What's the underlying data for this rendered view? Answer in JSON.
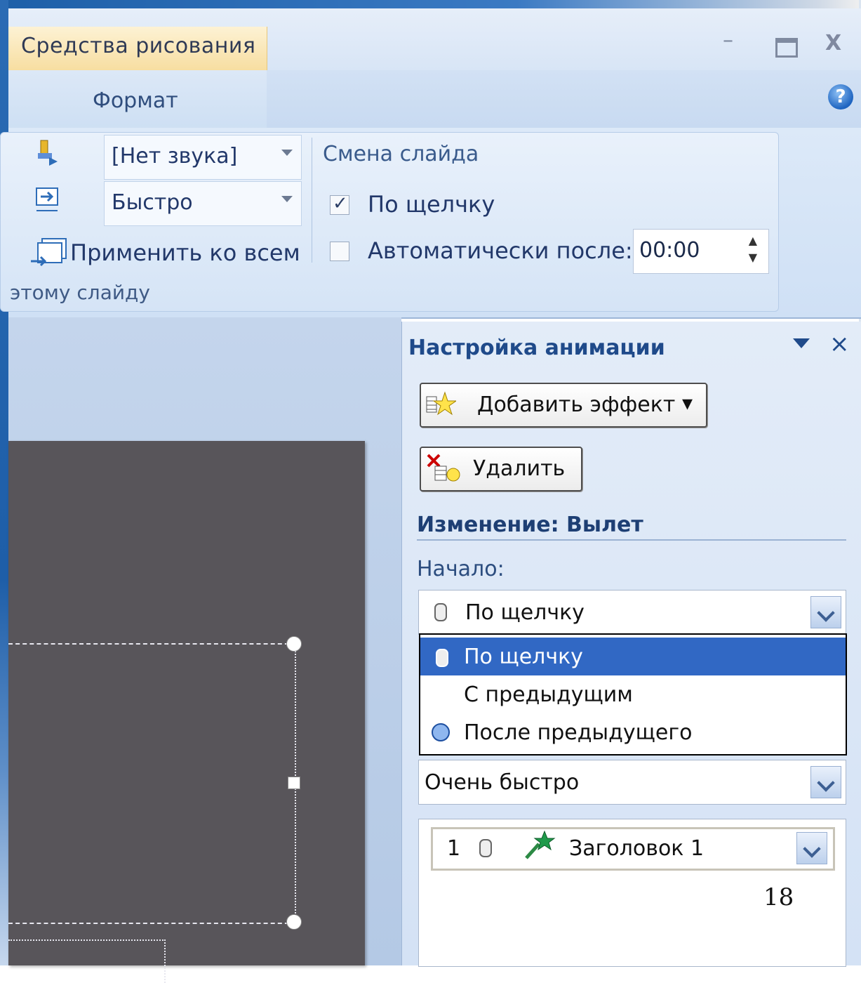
{
  "window": {
    "context_tab": "Средства рисования",
    "min": "–",
    "close": "X",
    "help": "?"
  },
  "tabs": {
    "format": "Формат"
  },
  "ribbon": {
    "sound_value": "[Нет звука]",
    "speed_value": "Быстро",
    "apply_all": "Применить ко всем",
    "group_label": "этому слайду",
    "slide_change_title": "Смена слайда",
    "on_click_label": "По щелчку",
    "on_click_checked": true,
    "auto_after_label": "Автоматически после:",
    "auto_after_checked": false,
    "auto_time": "00:00"
  },
  "pane": {
    "title": "Настройка анимации",
    "close": "×",
    "add_effect": "Добавить эффект",
    "add_arrow": "▾",
    "delete": "Удалить",
    "change_title": "Изменение: Вылет",
    "start_label": "Начало:",
    "start_value": "По щелчку",
    "start_options": [
      {
        "label": "По щелчку",
        "icon": "mouse-icon",
        "selected": true
      },
      {
        "label": "С предыдущим",
        "icon": "",
        "selected": false
      },
      {
        "label": "После предыдущего",
        "icon": "clock-icon",
        "selected": false
      }
    ],
    "speed_value": "Очень быстро",
    "sequence": [
      {
        "num": "1",
        "name": "Заголовок 1"
      }
    ]
  },
  "page_number": "18",
  "colors": {
    "selection": "#3168c4",
    "pane_title": "#1f4a8a",
    "slide_bg": "#58555a"
  }
}
